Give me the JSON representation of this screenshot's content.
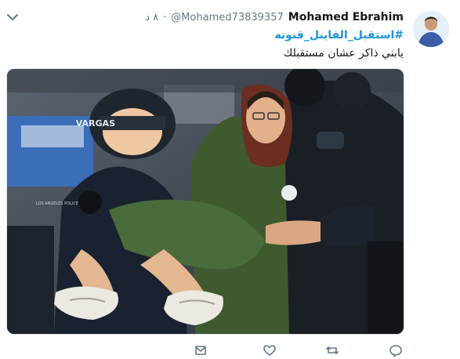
{
  "tweet": {
    "author_name": "Mohamed Ebrahim",
    "author_handle": "@Mohamed73839357",
    "time_separator": "·",
    "timestamp": "٨ د",
    "hashtag": "#استقبل_الفاينل_قنوته",
    "text": "يابني ذاكر عشان مستقبلك"
  },
  "media": {
    "description_icon": "photo",
    "helmet_text": "VARGAS",
    "badge_text": "LOS ANGELES POLICE"
  },
  "actions": {
    "reply_icon": "reply-icon",
    "retweet_icon": "retweet-icon",
    "like_icon": "heart-icon",
    "dm_icon": "mail-icon"
  },
  "colors": {
    "link": "#1b95e0",
    "muted": "#657786",
    "text": "#14171a"
  }
}
